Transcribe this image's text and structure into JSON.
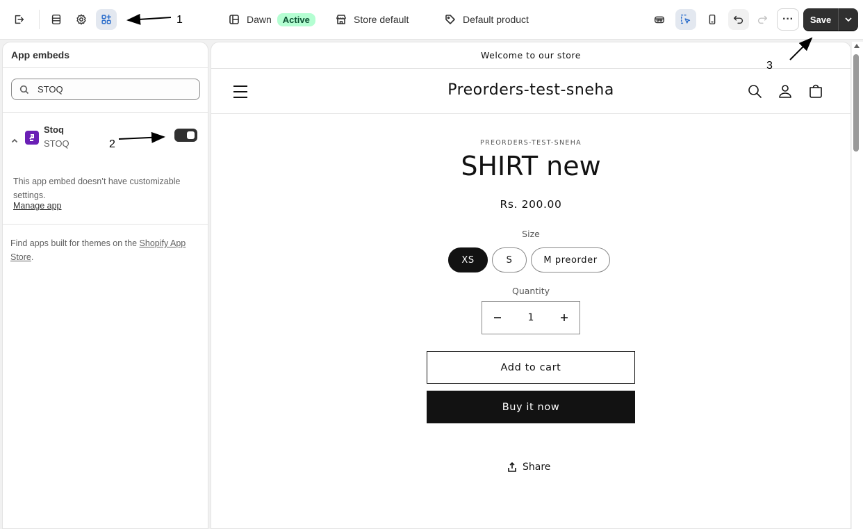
{
  "topbar": {
    "theme_name": "Dawn",
    "theme_status": "Active",
    "store_template": "Store default",
    "product_template": "Default product",
    "more_label": "···",
    "save_label": "Save"
  },
  "panel": {
    "title": "App embeds",
    "search_value": "STOQ",
    "app": {
      "name": "Stoq",
      "subtitle": "STOQ",
      "enabled": true
    },
    "note": "This app embed doesn’t have customizable settings.",
    "manage_link": "Manage app",
    "find_text": "Find apps built for themes on the ",
    "find_link": "Shopify App Store",
    "find_end": "."
  },
  "preview": {
    "announcement": "Welcome to our store",
    "store_name": "Preorders-test-sneha",
    "vendor": "PREORDERS-TEST-SNEHA",
    "product_title": "SHIRT new",
    "price": "Rs. 200.00",
    "size_label": "Size",
    "sizes": [
      "XS",
      "S",
      "M preorder"
    ],
    "selected_size": "XS",
    "quantity_label": "Quantity",
    "quantity": "1",
    "add_to_cart": "Add to cart",
    "buy_now": "Buy it now",
    "share": "Share"
  },
  "annotations": {
    "a1": "1",
    "a2": "2",
    "a3": "3"
  }
}
